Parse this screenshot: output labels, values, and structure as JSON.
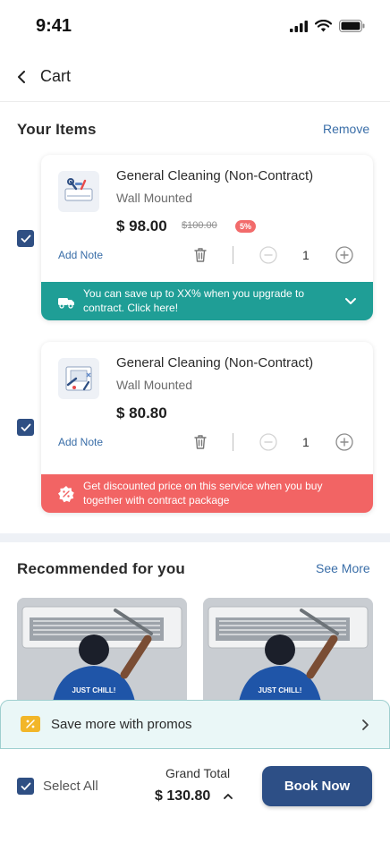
{
  "status": {
    "time": "9:41"
  },
  "nav": {
    "title": "Cart"
  },
  "items_section": {
    "title": "Your Items",
    "remove_label": "Remove"
  },
  "items": [
    {
      "checked": true,
      "title": "General Cleaning (Non-Contract)",
      "subtitle": "Wall Mounted",
      "price": "$ 98.00",
      "original_price": "$100.00",
      "discount": "5%",
      "add_note": "Add Note",
      "quantity": "1",
      "banner_text": "You can save up to XX% when you upgrade to contract. Click here!",
      "banner_color": "#1f9e96"
    },
    {
      "checked": true,
      "title": "General Cleaning (Non-Contract)",
      "subtitle": "Wall Mounted",
      "price": "$ 80.80",
      "add_note": "Add Note",
      "quantity": "1",
      "banner_text": "Get discounted price on this service when you buy together with contract package",
      "banner_color": "#f26464"
    }
  ],
  "recommended": {
    "title": "Recommended for you",
    "see_more": "See More",
    "shirt_text": "JUST CHILL!"
  },
  "promo": {
    "label": "Save more with promos"
  },
  "footer": {
    "select_all_label": "Select All",
    "grand_total_label": "Grand Total",
    "grand_total_value": "$ 130.80",
    "book_now_label": "Book Now"
  },
  "colors": {
    "primary": "#2d4f86",
    "link": "#3a6ea8",
    "teal": "#1f9e96",
    "red": "#f26464"
  }
}
